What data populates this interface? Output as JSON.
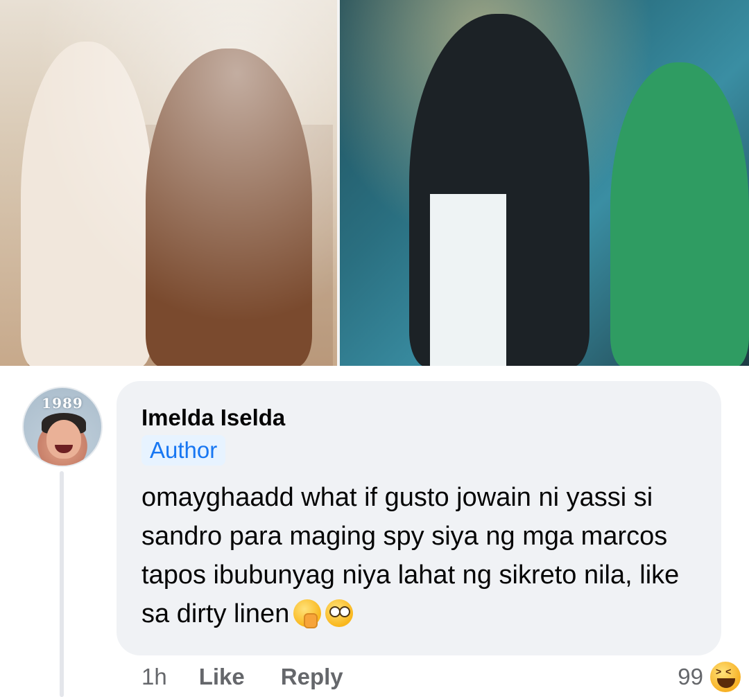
{
  "comment": {
    "avatar_label": "1989",
    "author_name": "Imelda Iselda",
    "author_badge": "Author",
    "text": "omayghaadd what if gusto jowain ni yassi si sandro para maging spy siya ng mga marcos tapos ibubunyag niya lahat ng sikreto nila, like sa dirty linen",
    "emojis": [
      "face-with-hand-over-mouth-icon",
      "flushed-face-icon"
    ],
    "time": "1h",
    "like_label": "Like",
    "reply_label": "Reply",
    "reaction_count": "99",
    "reaction_icon": "haha-icon"
  },
  "colors": {
    "bubble_bg": "#f0f2f5",
    "badge_bg": "#e7f3ff",
    "badge_text": "#1877f2",
    "secondary_text": "#65676b",
    "primary_text": "#050505"
  }
}
